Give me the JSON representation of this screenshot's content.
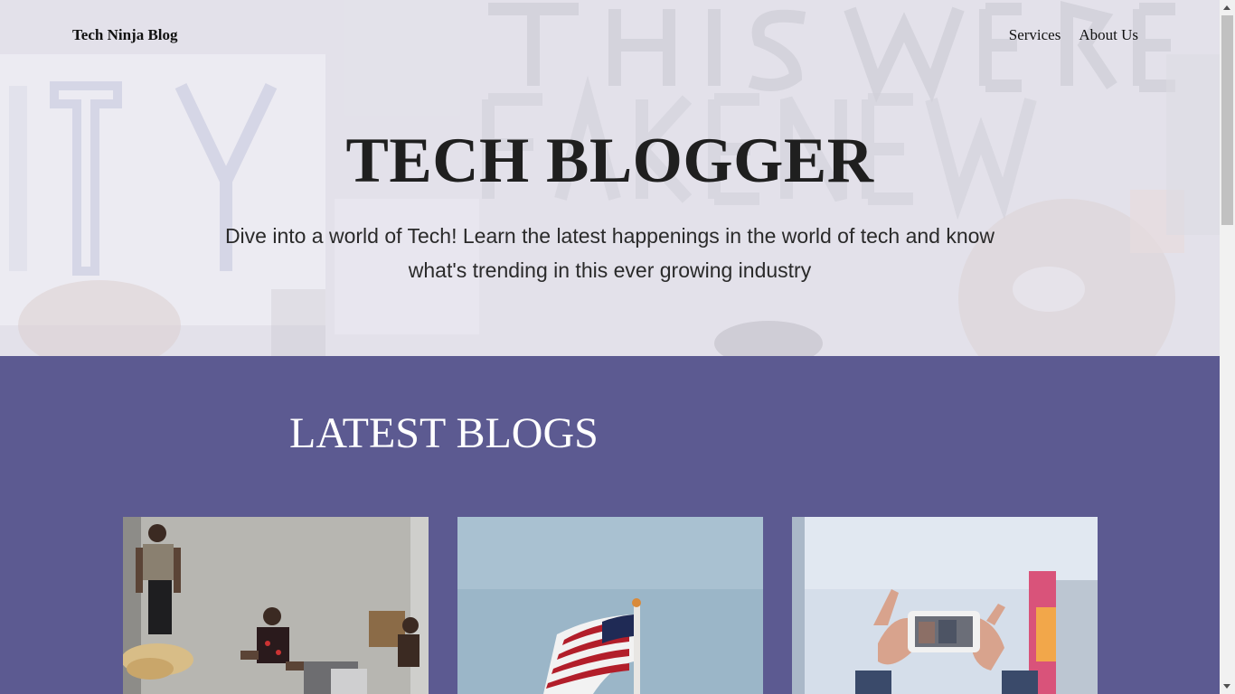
{
  "nav": {
    "brand": "Tech Ninja Blog",
    "links": [
      "Services",
      "About Us"
    ]
  },
  "hero": {
    "title": "TECH BLOGGER",
    "subtitle": "Dive into a world of Tech! Learn the latest happenings in the world of tech and know what's trending in this ever growing industry"
  },
  "latest": {
    "title": "LATEST BLOGS"
  },
  "colors": {
    "section_bg": "#5c5a91",
    "hero_overlay": "#eceaf3"
  }
}
